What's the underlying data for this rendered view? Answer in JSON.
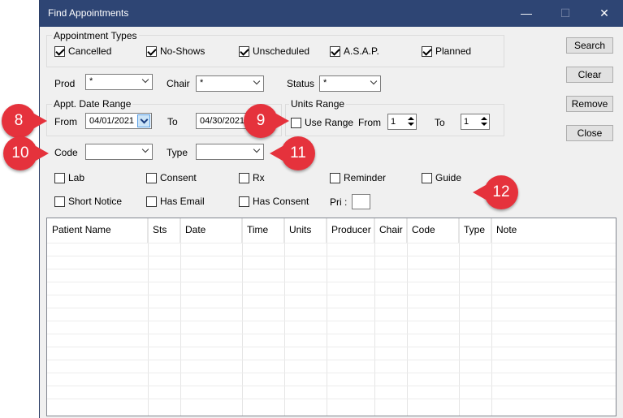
{
  "window": {
    "title": "Find Appointments",
    "minimize": "—",
    "maximize": "☐",
    "close": "✕"
  },
  "appointment_types": {
    "label": "Appointment Types",
    "items": [
      {
        "label": "Cancelled",
        "checked": true
      },
      {
        "label": "No-Shows",
        "checked": true
      },
      {
        "label": "Unscheduled",
        "checked": true
      },
      {
        "label": "A.S.A.P.",
        "checked": true
      },
      {
        "label": "Planned",
        "checked": true
      }
    ]
  },
  "filters": {
    "prod_label": "Prod",
    "prod_value": "*",
    "chair_label": "Chair",
    "chair_value": "*",
    "status_label": "Status",
    "status_value": "*"
  },
  "date_range": {
    "label": "Appt. Date Range",
    "from_label": "From",
    "from_value": "04/01/2021",
    "to_label": "To",
    "to_value": "04/30/2021"
  },
  "units_range": {
    "label": "Units Range",
    "use_label": "Use Range",
    "use_checked": false,
    "from_label": "From",
    "from_value": "1",
    "to_label": "To",
    "to_value": "1"
  },
  "code": {
    "label": "Code",
    "value": ""
  },
  "type": {
    "label": "Type",
    "value": ""
  },
  "options": [
    {
      "label": "Lab"
    },
    {
      "label": "Consent"
    },
    {
      "label": "Rx"
    },
    {
      "label": "Reminder"
    },
    {
      "label": "Guide"
    },
    {
      "label": "Short Notice"
    },
    {
      "label": "Has Email"
    },
    {
      "label": "Has Consent"
    }
  ],
  "pri_label": "Pri :",
  "buttons": {
    "search": "Search",
    "clear": "Clear",
    "remove": "Remove",
    "close": "Close"
  },
  "table": {
    "columns": [
      "Patient Name",
      "Sts",
      "Date",
      "Time",
      "Units",
      "Producer",
      "Chair",
      "Code",
      "Type",
      "Note"
    ]
  },
  "badges": {
    "b8": "8",
    "b9": "9",
    "b10": "10",
    "b11": "11",
    "b12": "12"
  },
  "colors": {
    "titlebar": "#2e4574",
    "badge": "#e5323c"
  }
}
